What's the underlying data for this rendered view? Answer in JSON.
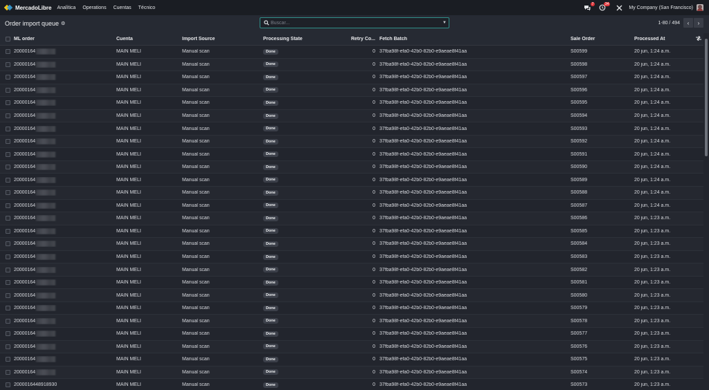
{
  "navbar": {
    "brand": "MercadoLibre",
    "menu": [
      "Analítica",
      "Operations",
      "Cuentas",
      "Técnico"
    ],
    "chat_badge": "7",
    "activity_badge": "34",
    "company": "My Company (San Francisco)"
  },
  "control": {
    "title": "Order import queue",
    "search_placeholder": "Buscar...",
    "pager": "1-80 / 494"
  },
  "table": {
    "columns": {
      "ml_order": "ML order",
      "cuenta": "Cuenta",
      "source": "Import Source",
      "state": "Processing State",
      "retry": "Retry Co...",
      "batch": "Fetch Batch",
      "sale": "Sale Order",
      "processed": "Processed At"
    },
    "rows": [
      {
        "ml_order": "20000164",
        "cuenta": "MAIN MELI",
        "source": "Manual scan",
        "state": "Done",
        "retry": "0",
        "batch": "37fba98f-efa0-42b0-82b0-e9aeae8f41aa",
        "sale": "S00599",
        "processed": "20 jun, 1:24 a.m."
      },
      {
        "ml_order": "20000164",
        "cuenta": "MAIN MELI",
        "source": "Manual scan",
        "state": "Done",
        "retry": "0",
        "batch": "37fba98f-efa0-42b0-82b0-e9aeae8f41aa",
        "sale": "S00598",
        "processed": "20 jun, 1:24 a.m."
      },
      {
        "ml_order": "20000164",
        "cuenta": "MAIN MELI",
        "source": "Manual scan",
        "state": "Done",
        "retry": "0",
        "batch": "37fba98f-efa0-42b0-82b0-e9aeae8f41aa",
        "sale": "S00597",
        "processed": "20 jun, 1:24 a.m."
      },
      {
        "ml_order": "20000164",
        "cuenta": "MAIN MELI",
        "source": "Manual scan",
        "state": "Done",
        "retry": "0",
        "batch": "37fba98f-efa0-42b0-82b0-e9aeae8f41aa",
        "sale": "S00596",
        "processed": "20 jun, 1:24 a.m."
      },
      {
        "ml_order": "20000164",
        "cuenta": "MAIN MELI",
        "source": "Manual scan",
        "state": "Done",
        "retry": "0",
        "batch": "37fba98f-efa0-42b0-82b0-e9aeae8f41aa",
        "sale": "S00595",
        "processed": "20 jun, 1:24 a.m."
      },
      {
        "ml_order": "20000164",
        "cuenta": "MAIN MELI",
        "source": "Manual scan",
        "state": "Done",
        "retry": "0",
        "batch": "37fba98f-efa0-42b0-82b0-e9aeae8f41aa",
        "sale": "S00594",
        "processed": "20 jun, 1:24 a.m."
      },
      {
        "ml_order": "20000164",
        "cuenta": "MAIN MELI",
        "source": "Manual scan",
        "state": "Done",
        "retry": "0",
        "batch": "37fba98f-efa0-42b0-82b0-e9aeae8f41aa",
        "sale": "S00593",
        "processed": "20 jun, 1:24 a.m."
      },
      {
        "ml_order": "20000164",
        "cuenta": "MAIN MELI",
        "source": "Manual scan",
        "state": "Done",
        "retry": "0",
        "batch": "37fba98f-efa0-42b0-82b0-e9aeae8f41aa",
        "sale": "S00592",
        "processed": "20 jun, 1:24 a.m."
      },
      {
        "ml_order": "20000164",
        "cuenta": "MAIN MELI",
        "source": "Manual scan",
        "state": "Done",
        "retry": "0",
        "batch": "37fba98f-efa0-42b0-82b0-e9aeae8f41aa",
        "sale": "S00591",
        "processed": "20 jun, 1:24 a.m."
      },
      {
        "ml_order": "20000164",
        "cuenta": "MAIN MELI",
        "source": "Manual scan",
        "state": "Done",
        "retry": "0",
        "batch": "37fba98f-efa0-42b0-82b0-e9aeae8f41aa",
        "sale": "S00590",
        "processed": "20 jun, 1:24 a.m."
      },
      {
        "ml_order": "20000164",
        "cuenta": "MAIN MELI",
        "source": "Manual scan",
        "state": "Done",
        "retry": "0",
        "batch": "37fba98f-efa0-42b0-82b0-e9aeae8f41aa",
        "sale": "S00589",
        "processed": "20 jun, 1:24 a.m."
      },
      {
        "ml_order": "20000164",
        "cuenta": "MAIN MELI",
        "source": "Manual scan",
        "state": "Done",
        "retry": "0",
        "batch": "37fba98f-efa0-42b0-82b0-e9aeae8f41aa",
        "sale": "S00588",
        "processed": "20 jun, 1:24 a.m."
      },
      {
        "ml_order": "20000164",
        "cuenta": "MAIN MELI",
        "source": "Manual scan",
        "state": "Done",
        "retry": "0",
        "batch": "37fba98f-efa0-42b0-82b0-e9aeae8f41aa",
        "sale": "S00587",
        "processed": "20 jun, 1:24 a.m."
      },
      {
        "ml_order": "20000164",
        "cuenta": "MAIN MELI",
        "source": "Manual scan",
        "state": "Done",
        "retry": "0",
        "batch": "37fba98f-efa0-42b0-82b0-e9aeae8f41aa",
        "sale": "S00586",
        "processed": "20 jun, 1:23 a.m."
      },
      {
        "ml_order": "20000164",
        "cuenta": "MAIN MELI",
        "source": "Manual scan",
        "state": "Done",
        "retry": "0",
        "batch": "37fba98f-efa0-42b0-82b0-e9aeae8f41aa",
        "sale": "S00585",
        "processed": "20 jun, 1:23 a.m."
      },
      {
        "ml_order": "20000164",
        "cuenta": "MAIN MELI",
        "source": "Manual scan",
        "state": "Done",
        "retry": "0",
        "batch": "37fba98f-efa0-42b0-82b0-e9aeae8f41aa",
        "sale": "S00584",
        "processed": "20 jun, 1:23 a.m."
      },
      {
        "ml_order": "20000164",
        "cuenta": "MAIN MELI",
        "source": "Manual scan",
        "state": "Done",
        "retry": "0",
        "batch": "37fba98f-efa0-42b0-82b0-e9aeae8f41aa",
        "sale": "S00583",
        "processed": "20 jun, 1:23 a.m."
      },
      {
        "ml_order": "20000164",
        "cuenta": "MAIN MELI",
        "source": "Manual scan",
        "state": "Done",
        "retry": "0",
        "batch": "37fba98f-efa0-42b0-82b0-e9aeae8f41aa",
        "sale": "S00582",
        "processed": "20 jun, 1:23 a.m."
      },
      {
        "ml_order": "20000164",
        "cuenta": "MAIN MELI",
        "source": "Manual scan",
        "state": "Done",
        "retry": "0",
        "batch": "37fba98f-efa0-42b0-82b0-e9aeae8f41aa",
        "sale": "S00581",
        "processed": "20 jun, 1:23 a.m."
      },
      {
        "ml_order": "20000164",
        "cuenta": "MAIN MELI",
        "source": "Manual scan",
        "state": "Done",
        "retry": "0",
        "batch": "37fba98f-efa0-42b0-82b0-e9aeae8f41aa",
        "sale": "S00580",
        "processed": "20 jun, 1:23 a.m."
      },
      {
        "ml_order": "20000164",
        "cuenta": "MAIN MELI",
        "source": "Manual scan",
        "state": "Done",
        "retry": "0",
        "batch": "37fba98f-efa0-42b0-82b0-e9aeae8f41aa",
        "sale": "S00579",
        "processed": "20 jun, 1:23 a.m."
      },
      {
        "ml_order": "20000164",
        "cuenta": "MAIN MELI",
        "source": "Manual scan",
        "state": "Done",
        "retry": "0",
        "batch": "37fba98f-efa0-42b0-82b0-e9aeae8f41aa",
        "sale": "S00578",
        "processed": "20 jun, 1:23 a.m."
      },
      {
        "ml_order": "20000164",
        "cuenta": "MAIN MELI",
        "source": "Manual scan",
        "state": "Done",
        "retry": "0",
        "batch": "37fba98f-efa0-42b0-82b0-e9aeae8f41aa",
        "sale": "S00577",
        "processed": "20 jun, 1:23 a.m."
      },
      {
        "ml_order": "20000164",
        "cuenta": "MAIN MELI",
        "source": "Manual scan",
        "state": "Done",
        "retry": "0",
        "batch": "37fba98f-efa0-42b0-82b0-e9aeae8f41aa",
        "sale": "S00576",
        "processed": "20 jun, 1:23 a.m."
      },
      {
        "ml_order": "20000164",
        "cuenta": "MAIN MELI",
        "source": "Manual scan",
        "state": "Done",
        "retry": "0",
        "batch": "37fba98f-efa0-42b0-82b0-e9aeae8f41aa",
        "sale": "S00575",
        "processed": "20 jun, 1:23 a.m."
      },
      {
        "ml_order": "20000164",
        "cuenta": "MAIN MELI",
        "source": "Manual scan",
        "state": "Done",
        "retry": "0",
        "batch": "37fba98f-efa0-42b0-82b0-e9aeae8f41aa",
        "sale": "S00574",
        "processed": "20 jun, 1:23 a.m."
      },
      {
        "ml_order": "2000016448918930",
        "cuenta": "MAIN MELI",
        "source": "Manual scan",
        "state": "Done",
        "retry": "0",
        "batch": "37fba98f-efa0-42b0-82b0-e9aeae8f41aa",
        "sale": "S00573",
        "processed": "20 jun, 1:23 a.m."
      }
    ]
  }
}
